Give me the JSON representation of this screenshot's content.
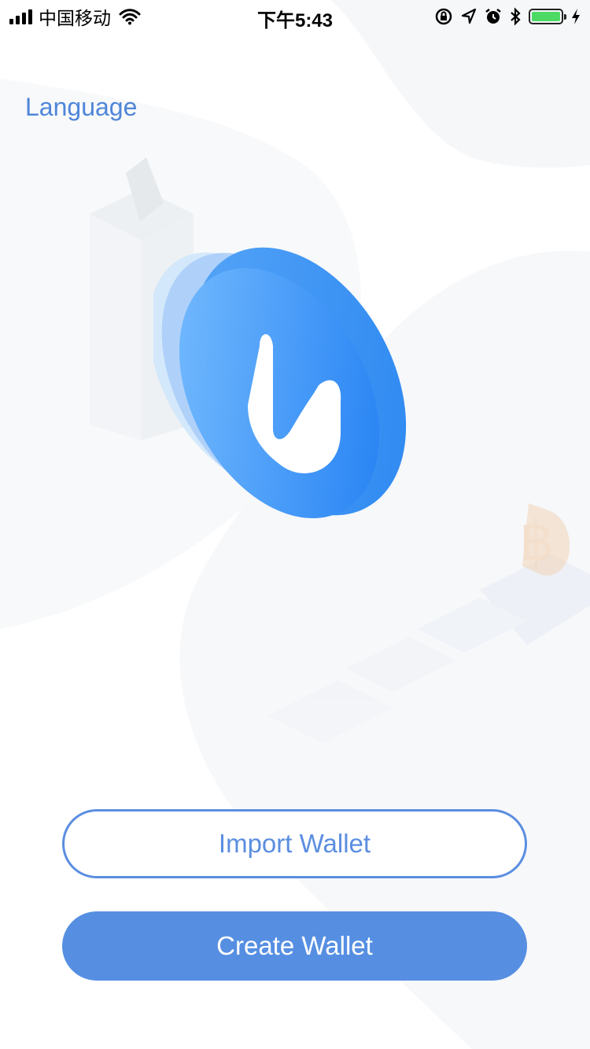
{
  "status_bar": {
    "carrier": "中国移动",
    "time": "下午5:43"
  },
  "header": {
    "language_label": "Language"
  },
  "actions": {
    "import_label": "Import Wallet",
    "create_label": "Create Wallet"
  },
  "colors": {
    "accent": "#568fe2",
    "link": "#4f86d9",
    "battery": "#4cd964"
  },
  "icons": [
    "signal-icon",
    "wifi-icon",
    "rotation-lock-icon",
    "location-icon",
    "alarm-icon",
    "bluetooth-icon",
    "battery-icon",
    "charging-icon",
    "app-logo-icon",
    "bitcoin-icon",
    "ballot-box-icon"
  ]
}
